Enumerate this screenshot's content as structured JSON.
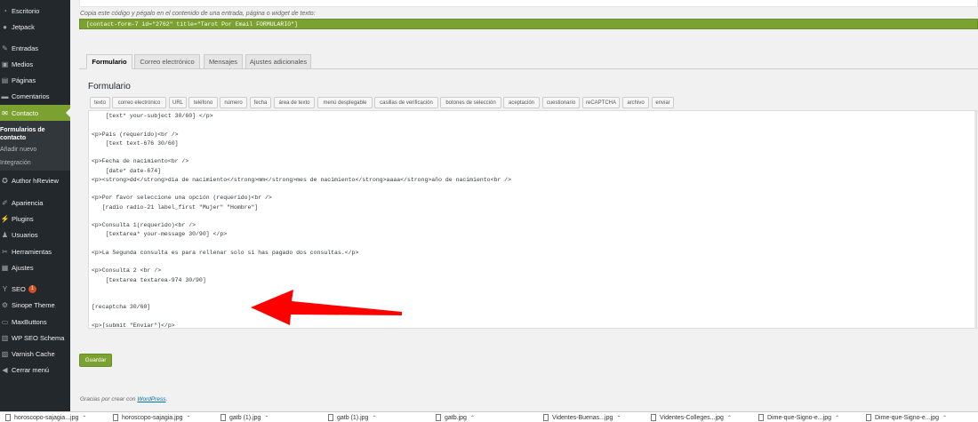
{
  "sidebar": {
    "items": [
      {
        "label": "Escritorio",
        "icon": "dashboard-icon",
        "glyph": "◔"
      },
      {
        "label": "Jetpack",
        "icon": "jetpack-icon",
        "glyph": "●"
      },
      {
        "label": "Entradas",
        "icon": "pushpin-icon",
        "glyph": "✎"
      },
      {
        "label": "Medios",
        "icon": "media-icon",
        "glyph": "▣"
      },
      {
        "label": "Páginas",
        "icon": "page-icon",
        "glyph": "▤"
      },
      {
        "label": "Comentarios",
        "icon": "comment-icon",
        "glyph": "▬"
      },
      {
        "label": "Contacto",
        "icon": "mail-icon",
        "glyph": "✉"
      },
      {
        "label": "Author hReview",
        "icon": "star-icon",
        "glyph": "✪"
      },
      {
        "label": "Apariencia",
        "icon": "paintbrush-icon",
        "glyph": "✐"
      },
      {
        "label": "Plugins",
        "icon": "plugin-icon",
        "glyph": "⚡"
      },
      {
        "label": "Usuarios",
        "icon": "users-icon",
        "glyph": "♟"
      },
      {
        "label": "Herramientas",
        "icon": "wrench-icon",
        "glyph": "✂"
      },
      {
        "label": "Ajustes",
        "icon": "settings-icon",
        "glyph": "▦"
      },
      {
        "label": "SEO",
        "icon": "yoast-icon",
        "glyph": "Y",
        "badge": "1"
      },
      {
        "label": "Sinope Theme",
        "icon": "gear-icon",
        "glyph": "⚙"
      },
      {
        "label": "MaxButtons",
        "icon": "button-icon",
        "glyph": "▭"
      },
      {
        "label": "WP SEO Schema",
        "icon": "schema-icon",
        "glyph": "▥"
      },
      {
        "label": "Varnish Cache",
        "icon": "cache-icon",
        "glyph": "▧"
      },
      {
        "label": "Cerrar menú",
        "icon": "collapse-icon",
        "glyph": "◀"
      }
    ],
    "submenu": [
      "Formularios de contacto",
      "Añadir nuevo",
      "Integración"
    ]
  },
  "shortcode": {
    "description": "Copia este código y pégalo en el contenido de una entrada, página o widget de texto:",
    "code": "[contact-form-7 id=\"2762\" title=\"Tarot Por Email FORMULARIO\"]"
  },
  "tabs": [
    "Formulario",
    "Correo electrónico",
    "Mensajes",
    "Ajustes adicionales"
  ],
  "panel_title": "Formulario",
  "tag_buttons": [
    "texto",
    "correo electrónico",
    "URL",
    "teléfono",
    "número",
    "fecha",
    "área de texto",
    "menú desplegable",
    "casillas de verificación",
    "botones de selección",
    "aceptación",
    "cuestionario",
    "reCAPTCHA",
    "archivo",
    "enviar"
  ],
  "code_lines": [
    "    [text* your-subject 30/60] </p>",
    "",
    "<p>Pais (requerido)<br />",
    "    [text text-676 30/60]",
    "",
    "<p>Fecha de nacimiento<br />",
    "    [date* date-674]",
    "<p><strong>dd</strong>dia de nacimiento</strong>mm</strong>mes de nacimiento</strong>aaaa</strong>año de nacimiento<br />",
    "",
    "<p>Por favor seleccione una opción (requerido)<br />",
    "   [radio radio-21 label_first \"Mujer\" \"Hombre\"]",
    "",
    "<p>Consulta 1(requerido)<br />",
    "    [textarea* your-message 30/90] </p>",
    "",
    "<p>La Segunda consulta es para rellenar solo si has pagado dos consultas.</p>",
    "",
    "<p>Consulta 2 <br />",
    "    [textarea textarea-974 30/90]",
    "",
    "",
    "[recaptcha 30/60]",
    "",
    "<p>[submit \"Enviar\"]</p>"
  ],
  "save_label": "Guardar",
  "footer": {
    "prefix": "Gracias por crear con ",
    "link": "WordPress",
    "suffix": "."
  },
  "downloads": [
    "horoscopo-sajagia...jpg",
    "horoscopo-sajagia.jpg",
    "gatb (1).jpg",
    "gatb (1).jpg",
    "gatb.jpg",
    "Videntes-Buenas...jpg",
    "Videntes-Colleges...jpg",
    "Dime-que-Signo-e...jpg",
    "Dime-que-Signo-e...jpg"
  ],
  "colors": {
    "sidebar": "#23282d",
    "accent": "#7ba230",
    "arrow": "#ff0000"
  }
}
